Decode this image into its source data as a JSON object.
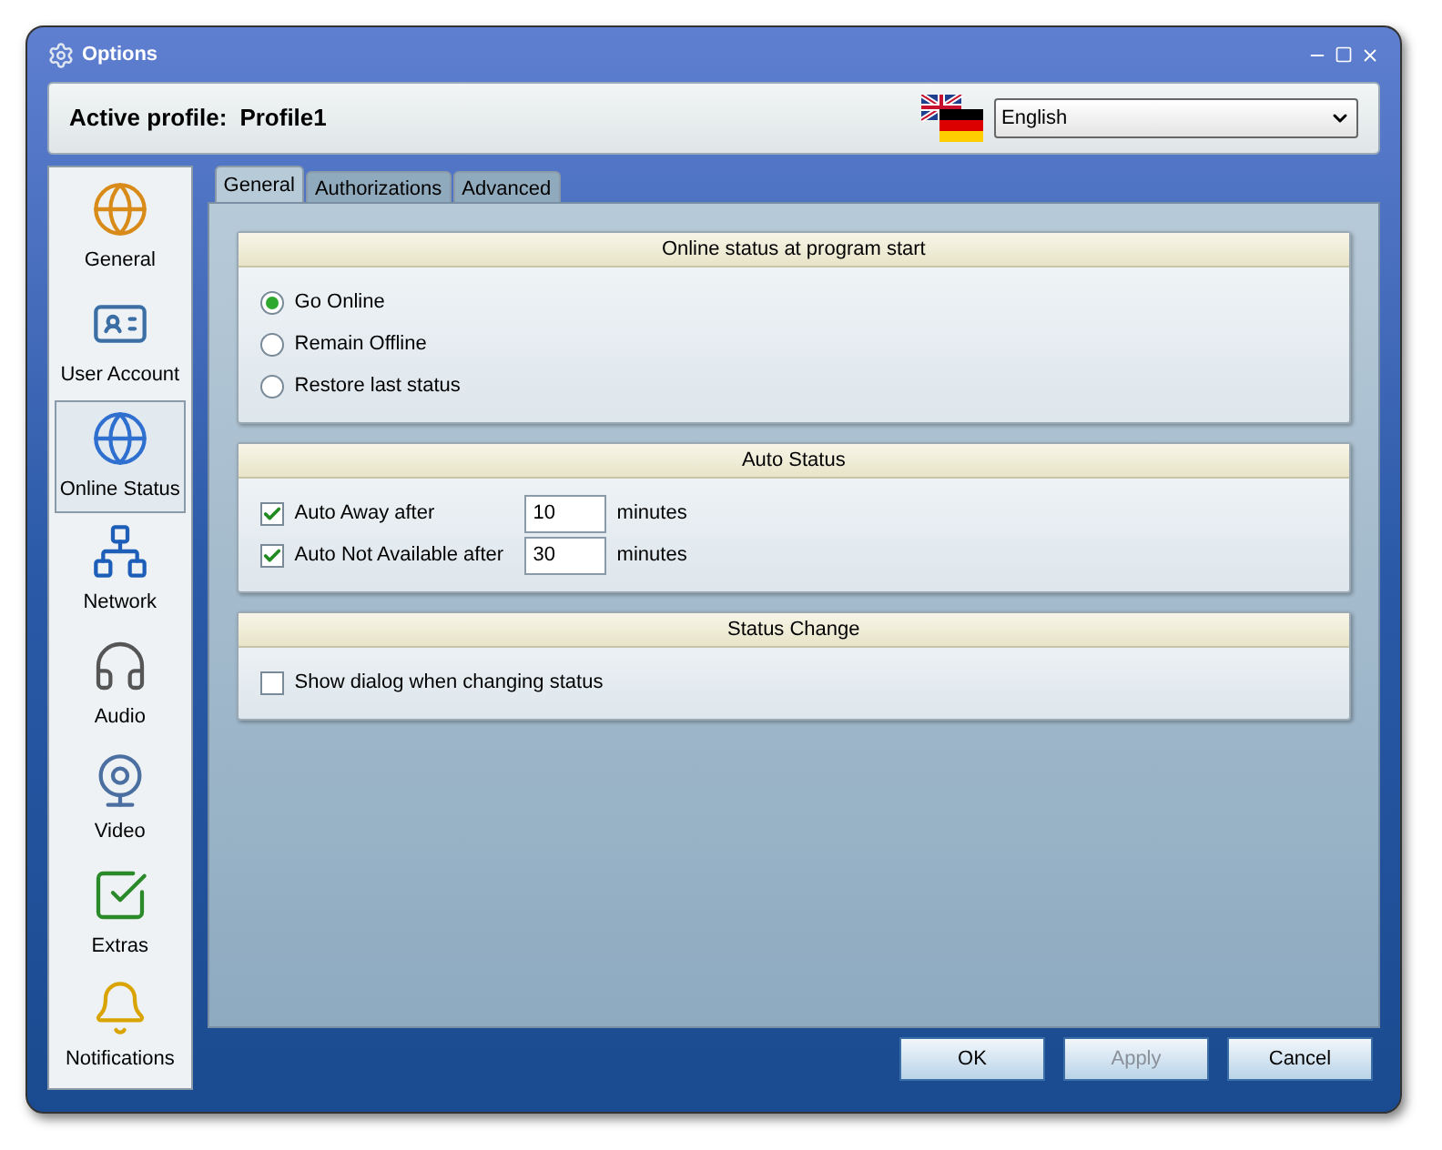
{
  "window": {
    "title": "Options"
  },
  "profile": {
    "label": "Active profile:",
    "value": "Profile1"
  },
  "language": {
    "value": "English"
  },
  "sidebar": {
    "items": [
      {
        "label": "General",
        "selected": false
      },
      {
        "label": "User Account",
        "selected": false
      },
      {
        "label": "Online Status",
        "selected": true
      },
      {
        "label": "Network",
        "selected": false
      },
      {
        "label": "Audio",
        "selected": false
      },
      {
        "label": "Video",
        "selected": false
      },
      {
        "label": "Extras",
        "selected": false
      },
      {
        "label": "Notifications",
        "selected": false
      }
    ]
  },
  "tabs": [
    {
      "label": "General",
      "selected": true
    },
    {
      "label": "Authorizations",
      "selected": false
    },
    {
      "label": "Advanced",
      "selected": false
    }
  ],
  "sections": [
    {
      "title": "Online status at program start",
      "rows": [
        {
          "kind": "radio",
          "label": "Go Online",
          "selected": true
        },
        {
          "kind": "radio",
          "label": "Remain Offline",
          "selected": false
        },
        {
          "kind": "radio",
          "label": "Restore last status",
          "selected": false
        }
      ]
    },
    {
      "title": "Auto Status",
      "rows": [
        {
          "kind": "checkbox",
          "label": "Auto Away after",
          "checked": true,
          "value": "10",
          "unit": "minutes"
        },
        {
          "kind": "checkbox",
          "label": "Auto Not Available after",
          "checked": true,
          "value": "30",
          "unit": "minutes"
        }
      ]
    },
    {
      "title": "Status Change",
      "rows": [
        {
          "kind": "checkbox",
          "label": "Show dialog when changing status",
          "checked": false
        }
      ]
    }
  ],
  "buttons": [
    {
      "label": "OK",
      "disabled": false
    },
    {
      "label": "Apply",
      "disabled": true
    },
    {
      "label": "Cancel",
      "disabled": false
    }
  ]
}
